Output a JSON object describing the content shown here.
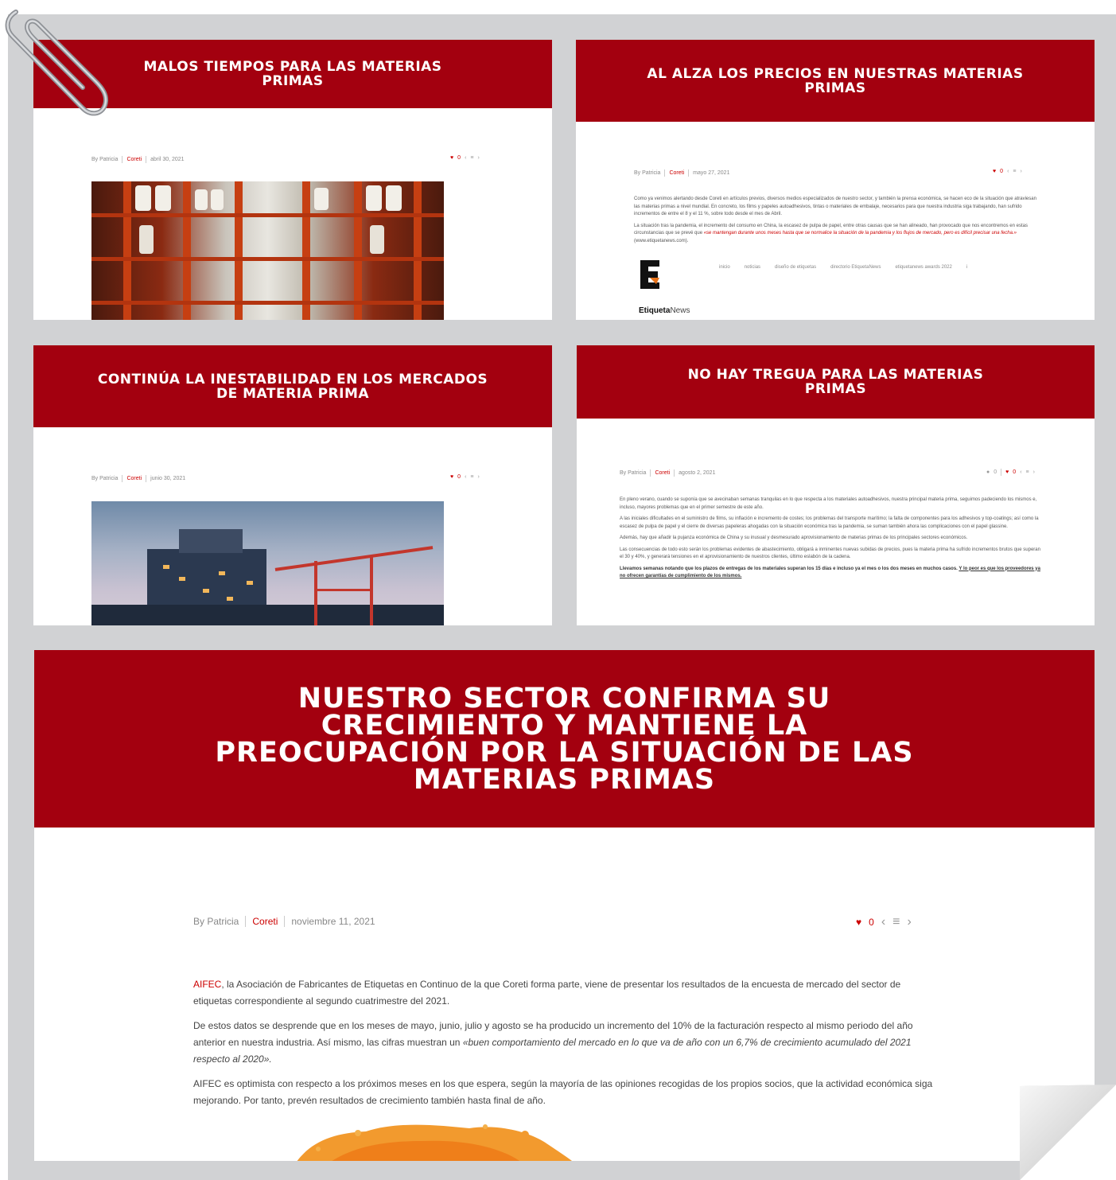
{
  "cards": [
    {
      "title": "MALOS TIEMPOS PARA LAS MATERIAS PRIMAS",
      "author": "By Patricia",
      "category": "Coreti",
      "date": "abril 30, 2021",
      "likes": "0"
    },
    {
      "title": "AL ALZA LOS PRECIOS EN NUESTRAS MATERIAS PRIMAS",
      "author": "By Patricia",
      "category": "Coreti",
      "date": "mayo 27, 2021",
      "likes": "0",
      "p1": "Como ya venimos alertando desde Coreti en artículos previos, diversos medios especializados de nuestro sector, y también la prensa económica, se hacen eco de la situación que atraviesan las materias primas a nivel mundial. En concreto, los films y papeles autoadhesivos, tintas o materiales de embalaje, necesarios para que nuestra industria siga trabajando, han sufrido incrementos de entre el 8 y el 11 %, sobre todo desde el mes de Abril.",
      "p2_start": "La situación tras la pandemia, el incremento del consumo en China, la escasez de pulpa de papel, entre otras causas que se han alineado, han provocado que nos encontremos en estas circunstancias que se prevé que ",
      "p2_quote": "«se mantengan durante unos meses hasta que se normalice la situación de la pandemia y los flujos de mercado, pero es difícil precisar una fecha.»",
      "p2_end": " (www.etiquetanews.com).",
      "nav": [
        "inicio",
        "noticias",
        "diseño de etiquetas",
        "directorio EtiquetaNews",
        "etiquetanews awards 2022",
        "i"
      ],
      "logo_bold": "Etiqueta",
      "logo_regular": "News"
    },
    {
      "title": "CONTINÚA LA INESTABILIDAD EN LOS MERCADOS DE MATERIA PRIMA",
      "author": "By Patricia",
      "category": "Coreti",
      "date": "junio 30, 2021",
      "likes": "0"
    },
    {
      "title": "NO HAY TREGUA PARA LAS MATERIAS PRIMAS",
      "author": "By Patricia",
      "category": "Coreti",
      "date": "agosto 2, 2021",
      "comments": "0",
      "likes": "0",
      "p1": "En pleno verano, cuando se suponía que se avecinaban semanas tranquilas en lo que respecta a los materiales autoadhesivos, nuestra principal materia prima, seguimos padeciendo los mismos e, incluso, mayores problemas que en el primer semestre de este año.",
      "p2": "A las iniciales dificultades en el suministro de films, su inflación e incremento de costes; los problemas del transporte marítimo; la falta de componentes para los adhesivos y top-coatings; así como la escasez de pulpa de papel y el cierre de diversas papeleras ahogadas con la situación económica tras la pandemia, se suman también ahora las complicaciones con el papel glassine.",
      "p3": "Además, hay que añadir la pujanza económica de China y su inusual y desmesurado aprovisionamiento de materias primas de los principales sectores económicos.",
      "p4": "Las consecuencias de todo esto serán los problemas evidentes de abastecimiento, obligará a inminentes nuevas subidas de precios, pues la materia prima ha sufrido incrementos brutos que superan el 30 y 40%, y generará tensiones en el aprovisionamiento de nuestros clientes, último eslabón de la cadena.",
      "p5_bold": "Llevamos semanas notando que los plazos de entregas de los materiales superan los 15 días e incluso ya el mes o los dos meses en muchos casos. ",
      "p5_underline": "Y lo peor es que los proveedores ya no ofrecen garantías de cumplimiento de los mismos."
    }
  ],
  "feature": {
    "title": "NUESTRO SECTOR CONFIRMA SU CRECIMIENTO Y MANTIENE LA PREOCUPACIÓN POR LA SITUACIÓN DE LAS MATERIAS PRIMAS",
    "author": "By Patricia",
    "category": "Coreti",
    "date": "noviembre 11, 2021",
    "likes": "0",
    "p1_link": "AIFEC",
    "p1_rest": ", la Asociación de Fabricantes de Etiquetas en Continuo de la que Coreti forma parte, viene de presentar los resultados de la encuesta de mercado del sector de etiquetas correspondiente al segundo cuatrimestre del 2021.",
    "p2_start": "De estos datos se desprende que en los meses de mayo, junio, julio y agosto se ha producido un incremento del 10% de la facturación respecto al mismo periodo del año anterior en nuestra industria. Así mismo, las cifras muestran un ",
    "p2_quote": "«buen comportamiento del mercado en lo que va de año con un 6,7% de crecimiento acumulado del 2021 respecto al 2020».",
    "p3": "AIFEC es optimista con respecto a los próximos meses en los que espera, según la mayoría de las opiniones recogidas de los propios socios, que la actividad económica siga mejorando. Por tanto, prevén resultados de crecimiento también hasta final de año."
  },
  "colors": {
    "banner": "#a3000f",
    "accent": "#cc0000",
    "board": "#d1d2d4"
  },
  "icons": [
    "heart-icon",
    "chevron-left-icon",
    "list-icon",
    "chevron-right-icon",
    "comment-icon",
    "paperclip-icon",
    "page-curl-icon"
  ]
}
